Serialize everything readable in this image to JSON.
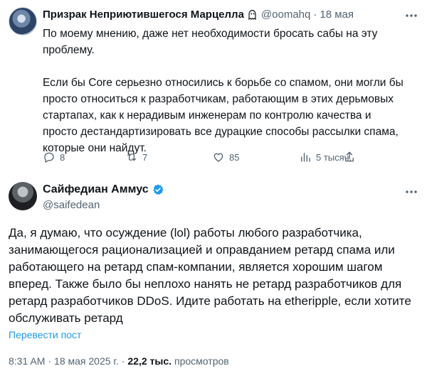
{
  "reply": {
    "author_name": "Призрак Неприютившегося Марцелла",
    "author_badge_icon": "ghost-icon",
    "handle": "@oomahq",
    "separator": "·",
    "date": "18 мая",
    "paragraph1": "По моему мнению, даже нет необходимости бросать сабы на эту проблему.",
    "paragraph2": "Если бы Core серьезно относились к борьбе со спамом, они могли бы просто относиться к разработчикам, работающим в этих дерьмовых стартапах, как к нерадивым инженерам по контролю качества и просто дестандартизировать все дурацкие способы рассылки спама, которые они найдут.",
    "stats": {
      "replies": "8",
      "reposts": "7",
      "likes": "85",
      "views": "5 тысяч."
    }
  },
  "main_post": {
    "author_name": "Сайфедиан Аммус",
    "verified_color": "#1d9bf0",
    "handle": "@saifedean",
    "text": "Да, я думаю, что осуждение (lol) работы любого разработчика, занимающегося рационализацией и оправданием ретард спама или работающего на ретард спам-компании, является хорошим шагом вперед. Также было бы неплохо нанять не ретард разработчиков для ретард разработчиков DDoS. Идите работать на etheripple, если хотите обслуживать ретард",
    "translate_label": "Перевести пост",
    "time": "8:31 AM",
    "separator": "·",
    "date": "18 мая 2025 г.",
    "views_count": "22,2 тыс.",
    "views_label": "просмотров"
  },
  "colors": {
    "text": "#0f1419",
    "muted": "#536471",
    "accent": "#1d9bf0"
  }
}
